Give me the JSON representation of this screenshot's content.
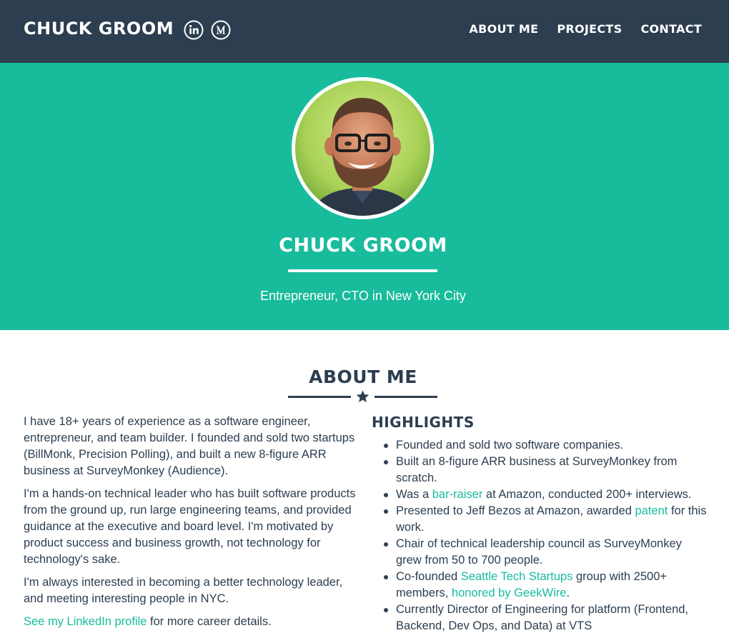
{
  "nav": {
    "brand": "CHUCK GROOM",
    "social": [
      "linkedin-icon",
      "medium-icon"
    ],
    "links": [
      "ABOUT ME",
      "PROJECTS",
      "CONTACT"
    ]
  },
  "masthead": {
    "name": "CHUCK GROOM",
    "tagline": "Entrepreneur, CTO in New York City"
  },
  "about": {
    "title": "ABOUT ME",
    "p1": "I have 18+ years of experience as a software engineer, entrepreneur, and team builder. I founded and sold two startups (BillMonk, Precision Polling), and built a new 8-figure ARR business at SurveyMonkey (Audience).",
    "p2": "I'm a hands-on technical leader who has built software products from the ground up, run large engineering teams, and provided guidance at the executive and board level. I'm motivated by product success and business growth, not technology for technology's sake.",
    "p3": "I'm always interested in becoming a better technology leader, and meeting interesting people in NYC.",
    "p4_link": "See my LinkedIn profile",
    "p4_rest": " for more career details."
  },
  "highlights": {
    "title": "HIGHLIGHTS",
    "h1": "Founded and sold two software companies.",
    "h2": "Built an 8-figure ARR business at SurveyMonkey from scratch.",
    "h3_pre": "Was a ",
    "h3_link": "bar-raiser",
    "h3_post": " at Amazon, conducted 200+ interviews.",
    "h4_pre": "Presented to Jeff Bezos at Amazon, awarded ",
    "h4_link": "patent",
    "h4_post": " for this work.",
    "h5": "Chair of technical leadership council as SurveyMonkey grew from 50 to 700 people.",
    "h6_pre": "Co-founded ",
    "h6_link1": "Seattle Tech Startups",
    "h6_mid": " group with 2500+ members, ",
    "h6_link2": "honored by GeekWire",
    "h6_post": ".",
    "h7": "Currently Director of Engineering for platform (Frontend, Backend, Dev Ops, and Data) at VTS"
  },
  "colors": {
    "navy": "#2c3e50",
    "teal": "#18bc9c",
    "white": "#ffffff"
  }
}
